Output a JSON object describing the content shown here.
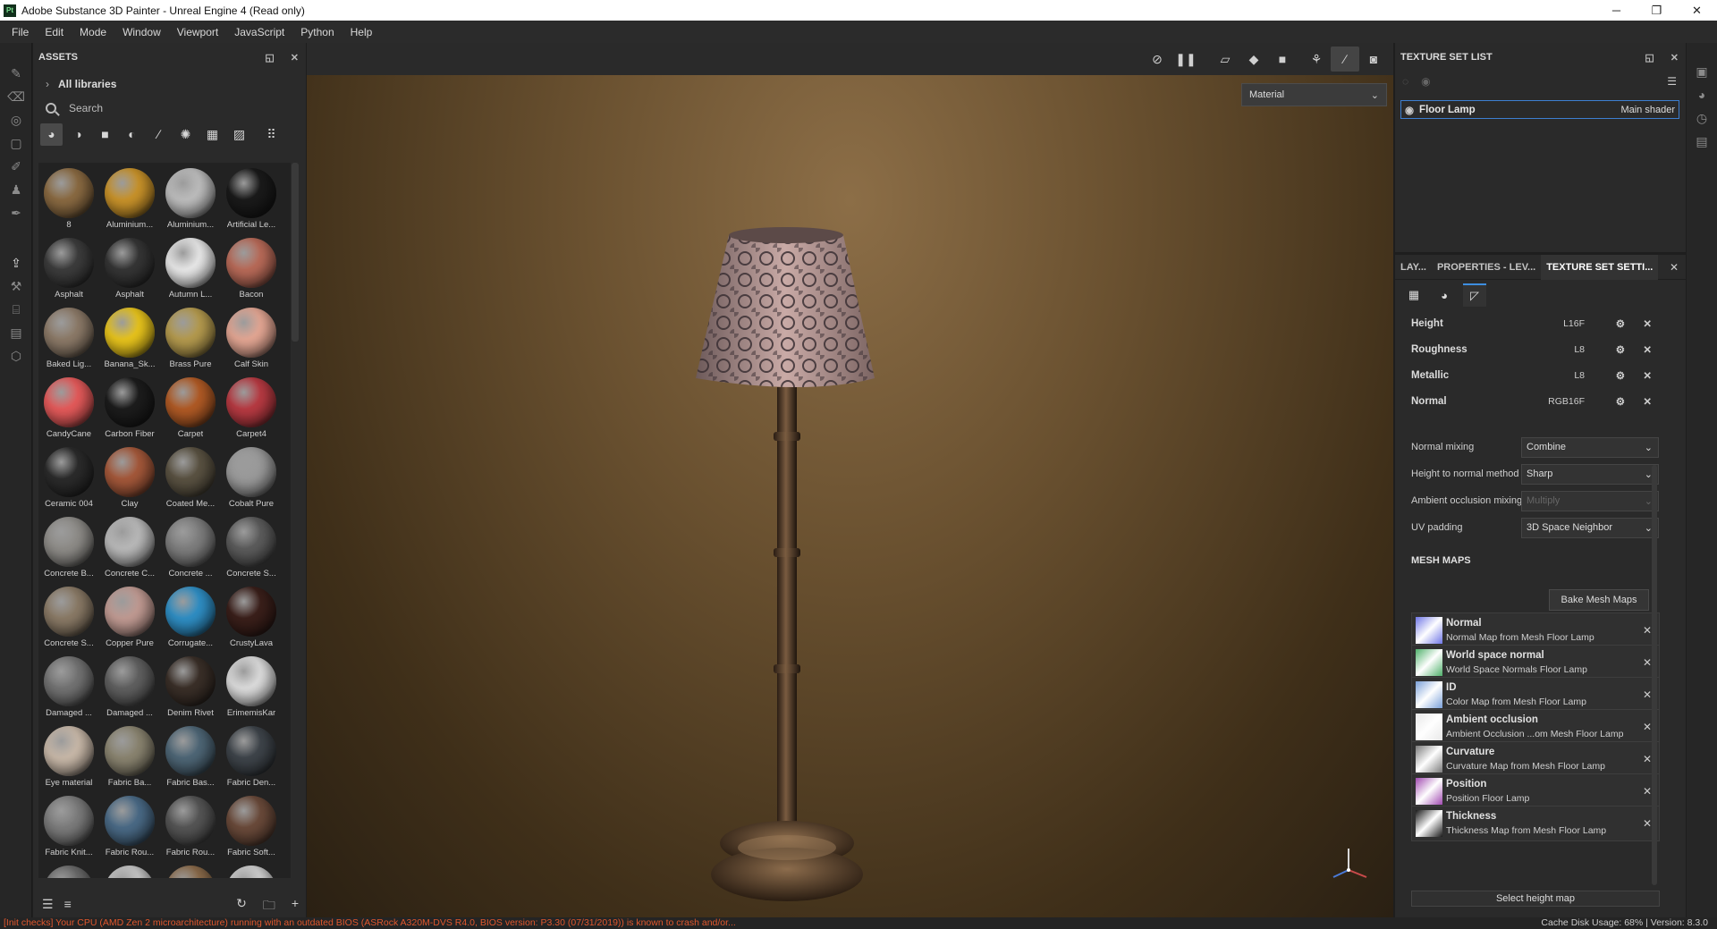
{
  "window": {
    "title": "Adobe Substance 3D Painter - Unreal Engine 4 (Read only)",
    "app_icon": "Pt"
  },
  "menu": [
    "File",
    "Edit",
    "Mode",
    "Window",
    "Viewport",
    "JavaScript",
    "Python",
    "Help"
  ],
  "assets": {
    "header": "ASSETS",
    "libraries": "All libraries",
    "search_placeholder": "Search",
    "materials": [
      {
        "name": "8",
        "color": "#8a6a42"
      },
      {
        "name": "Aluminium...",
        "color": "#c8922a"
      },
      {
        "name": "Aluminium...",
        "color": "#bdbdbd"
      },
      {
        "name": "Artificial Le...",
        "color": "#1a1a1a"
      },
      {
        "name": "Asphalt",
        "color": "#3c3c3c"
      },
      {
        "name": "Asphalt",
        "color": "#353535"
      },
      {
        "name": "Autumn L...",
        "color": "#e8e8e8"
      },
      {
        "name": "Bacon",
        "color": "#b86a58"
      },
      {
        "name": "Baked Lig...",
        "color": "#8c7a68"
      },
      {
        "name": "Banana_Sk...",
        "color": "#e7c31c"
      },
      {
        "name": "Brass Pure",
        "color": "#b49a4e"
      },
      {
        "name": "Calf Skin",
        "color": "#e3a693"
      },
      {
        "name": "CandyCane",
        "color": "#e45a5a"
      },
      {
        "name": "Carbon Fiber",
        "color": "#1c1c1c"
      },
      {
        "name": "Carpet",
        "color": "#b05a25"
      },
      {
        "name": "Carpet4",
        "color": "#b73a42"
      },
      {
        "name": "Ceramic 004",
        "color": "#2b2b2b"
      },
      {
        "name": "Clay",
        "color": "#a4583a"
      },
      {
        "name": "Coated Me...",
        "color": "#5a5242"
      },
      {
        "name": "Cobalt Pure",
        "color": "#9a9a9a"
      },
      {
        "name": "Concrete B...",
        "color": "#8e8c88"
      },
      {
        "name": "Concrete C...",
        "color": "#b9b9b9"
      },
      {
        "name": "Concrete ...",
        "color": "#7e7e7e"
      },
      {
        "name": "Concrete S...",
        "color": "#5c5c5c"
      },
      {
        "name": "Concrete S...",
        "color": "#8a7a66"
      },
      {
        "name": "Copper Pure",
        "color": "#c09a92"
      },
      {
        "name": "Corrugate...",
        "color": "#2f8ec4"
      },
      {
        "name": "CrustyLava",
        "color": "#3a1f1a"
      },
      {
        "name": "Damaged ...",
        "color": "#737373"
      },
      {
        "name": "Damaged ...",
        "color": "#606060"
      },
      {
        "name": "Denim Rivet",
        "color": "#3a2f28"
      },
      {
        "name": "ErimemisKar",
        "color": "#dcdcdc"
      },
      {
        "name": "Eye material",
        "color": "#c8b8a8"
      },
      {
        "name": "Fabric Ba...",
        "color": "#8a8470"
      },
      {
        "name": "Fabric Bas...",
        "color": "#4e6676"
      },
      {
        "name": "Fabric Den...",
        "color": "#3e444a"
      },
      {
        "name": "Fabric Knit...",
        "color": "#7c7c7c"
      },
      {
        "name": "Fabric Rou...",
        "color": "#4a6a86"
      },
      {
        "name": "Fabric Rou...",
        "color": "#555555"
      },
      {
        "name": "Fabric Soft...",
        "color": "#6a4a3a"
      },
      {
        "name": "",
        "color": "#6a6a6a"
      },
      {
        "name": "",
        "color": "#c6c6c6"
      },
      {
        "name": "",
        "color": "#8a6a4a"
      },
      {
        "name": "",
        "color": "#d0d0d0"
      }
    ]
  },
  "viewport": {
    "material_mode": "Material"
  },
  "texture_set_list": {
    "header": "TEXTURE SET LIST",
    "item_name": "Floor Lamp",
    "item_shader": "Main shader"
  },
  "texture_set_settings": {
    "tabs": [
      "LAY...",
      "PROPERTIES - LEV...",
      "TEXTURE SET SETTI..."
    ],
    "channels": [
      {
        "name": "Height",
        "format": "L16F"
      },
      {
        "name": "Roughness",
        "format": "L8"
      },
      {
        "name": "Metallic",
        "format": "L8"
      },
      {
        "name": "Normal",
        "format": "RGB16F"
      }
    ],
    "props": [
      {
        "label": "Normal mixing",
        "value": "Combine"
      },
      {
        "label": "Height to normal method",
        "value": "Sharp"
      },
      {
        "label": "Ambient occlusion mixing",
        "value": "Multiply"
      },
      {
        "label": "UV padding",
        "value": "3D Space Neighbor"
      }
    ],
    "mesh_maps_header": "MESH MAPS",
    "bake_button": "Bake Mesh Maps",
    "mesh_maps": [
      {
        "name": "Normal",
        "desc": "Normal Map from Mesh Floor Lamp",
        "color": "#6f76e6"
      },
      {
        "name": "World space normal",
        "desc": "World Space Normals Floor Lamp",
        "color": "#4fb06a"
      },
      {
        "name": "ID",
        "desc": "Color Map from Mesh Floor Lamp",
        "color": "#7aa0d8"
      },
      {
        "name": "Ambient occlusion",
        "desc": "Ambient Occlusion ...om Mesh Floor Lamp",
        "color": "#e8e8e8"
      },
      {
        "name": "Curvature",
        "desc": "Curvature Map from Mesh Floor Lamp",
        "color": "#7a7a7a"
      },
      {
        "name": "Position",
        "desc": "Position Floor Lamp",
        "color": "#a04ab0"
      },
      {
        "name": "Thickness",
        "desc": "Thickness Map from Mesh Floor Lamp",
        "color": "#1a1a1a"
      }
    ],
    "select_height_map": "Select height map"
  },
  "status": {
    "error": "[Init checks] Your CPU (AMD Zen 2 microarchitecture) running with an outdated BIOS (ASRock A320M-DVS R4.0, BIOS version: P3.30 (07/31/2019)) is known to crash and/or...",
    "cache": "Cache Disk Usage:   68% | Version: 8.3.0"
  }
}
